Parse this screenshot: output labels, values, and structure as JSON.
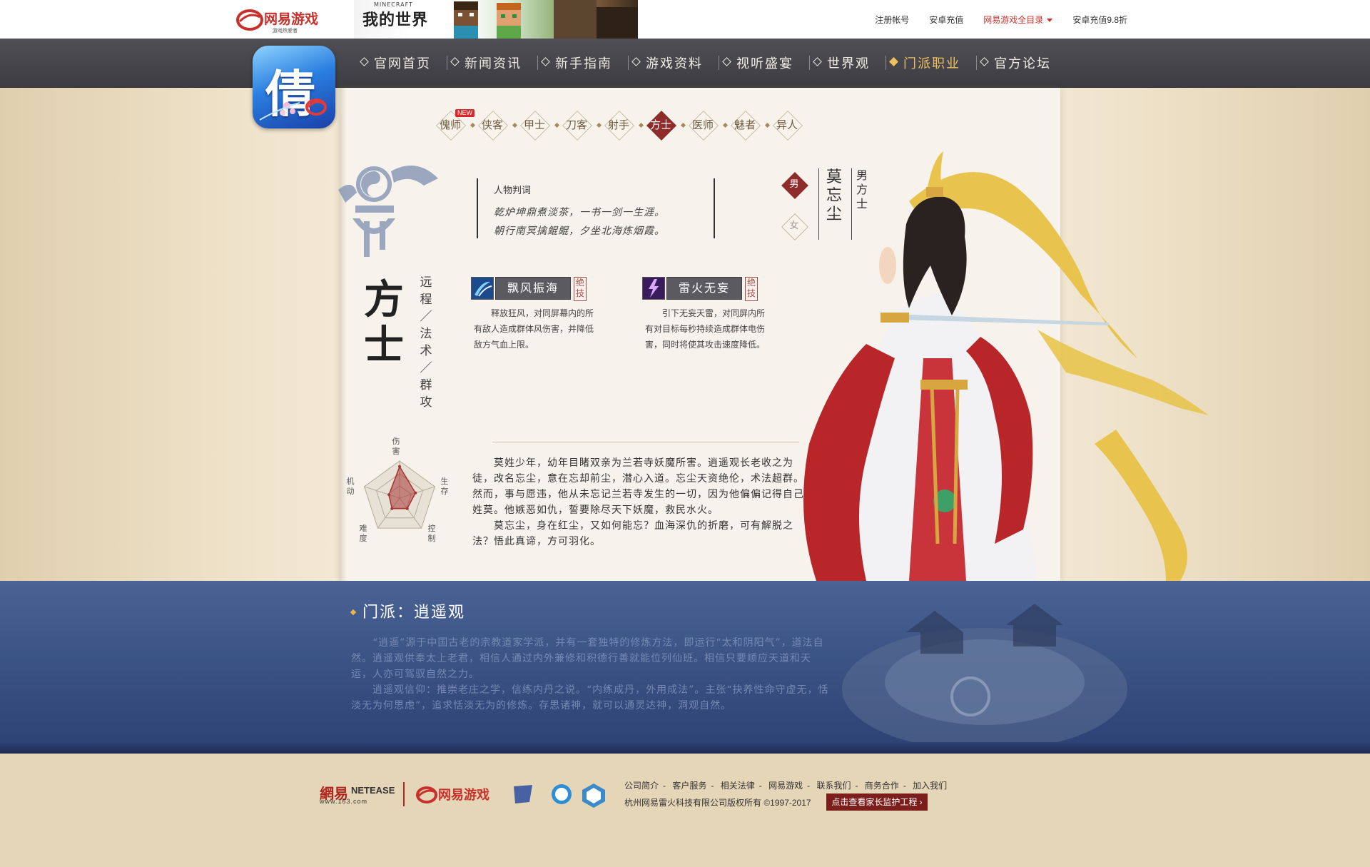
{
  "topbar": {
    "logo_text": "网易游戏",
    "logo_sub": "游戏热爱者",
    "banner_title": "我的世界",
    "banner_sub": "MINECRAFT",
    "links": {
      "register": "注册帐号",
      "recharge": "安卓充值",
      "catalog": "网易游戏全目录",
      "discount": "安卓充值9.8折"
    }
  },
  "logo": {
    "glyph": "倩"
  },
  "nav": {
    "items": [
      "官网首页",
      "新闻资讯",
      "新手指南",
      "游戏资料",
      "视听盛宴",
      "世界观",
      "门派职业",
      "官方论坛"
    ],
    "active": "门派职业"
  },
  "classes": {
    "tabs": [
      "傀师",
      "侠客",
      "甲士",
      "刀客",
      "射手",
      "方士",
      "医师",
      "魅者",
      "异人"
    ],
    "active": "方士",
    "new_tag": "NEW"
  },
  "character": {
    "quote_title": "人物判词",
    "quote_line1": "乾炉坤鼎煮淡茶，一书一剑一生涯。",
    "quote_line2": "朝行南冥擒鲲鲲，夕坐北海炼烟霞。",
    "gender_male": "男",
    "gender_female": "女",
    "name": "莫忘尘",
    "title_vertical": "男方士",
    "class_name": "方士",
    "class_desc": "远程／法术／群攻"
  },
  "skills": [
    {
      "name": "飘风振海",
      "badge": "绝技",
      "desc": "释放狂风，对同屏幕内的所有敌人造成群体风伤害，并降低敌方气血上限。"
    },
    {
      "name": "雷火无妄",
      "badge": "绝技",
      "desc": "引下无妄天雷，对同屏内所有对目标每秒持续造成群体电伤害，同时将使其攻击速度降低。"
    }
  ],
  "radar": {
    "labels": [
      "伤害",
      "生存",
      "控制",
      "难度",
      "机动"
    ],
    "values": [
      0.85,
      0.45,
      0.35,
      0.35,
      0.3
    ],
    "color": "#a83434"
  },
  "bio": {
    "p1": "莫姓少年，幼年目睹双亲为兰若寺妖魔所害。逍遥观长老收之为徒，改名忘尘，意在忘却前尘，潜心入道。忘尘天资绝伦，术法超群。然而，事与愿违，他从未忘记兰若寺发生的一切，因为他偏偏记得自己姓莫。他嫉恶如仇，誓要除尽天下妖魔，救民水火。",
    "p2": "莫忘尘，身在红尘，又如何能忘？血海深仇的折磨，可有解脱之法？悟此真谛，方可羽化。"
  },
  "sect": {
    "title": "门派：逍遥观",
    "p1": "“逍遥”源于中国古老的宗教道家学派，并有一套独特的修炼方法，即运行“太和阴阳气”，道法自然。逍遥观供奉太上老君，相信人通过内外兼修和积德行善就能位列仙班。相信只要顺应天道和天运，人亦可驾驭自然之力。",
    "p2": "逍遥观信仰：推崇老庄之学，信练内丹之说。“内练成丹，外用成法”。主张“抉养性命守虚无，恬淡无为何思虑”，追求恬淡无为的修炼。存思诸神，就可以通灵达神，洞观自然。"
  },
  "footer": {
    "ne_main": "網易",
    "ne_en": "NETEASE",
    "ne_url": "www.163.com",
    "game_logo": "网易游戏",
    "links": [
      "公司简介",
      "客户服务",
      "相关法律",
      "网易游戏",
      "联系我们",
      "商务合作",
      "加入我们"
    ],
    "copyright": "杭州网易雷火科技有限公司版权所有 ©1997-2017",
    "guard_button": "点击查看家长监护工程"
  },
  "colors": {
    "accent_red": "#8e2b2b",
    "nav_active": "#f0c060",
    "band_blue": "#3a5185"
  }
}
